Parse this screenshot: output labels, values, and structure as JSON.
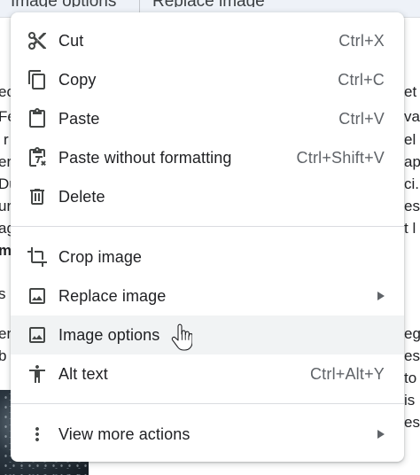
{
  "toolbar": {
    "buttons": [
      "Image options",
      "Replace image"
    ]
  },
  "document_fragments": {
    "left": [
      "ec",
      "Fe",
      "r",
      "er",
      "Du",
      "ur",
      "ag",
      "m",
      "s",
      "er",
      "b"
    ],
    "right": [
      "et",
      "va",
      "el",
      "ap",
      "ci.",
      "es",
      "t l",
      "eg",
      "es",
      "to",
      "is",
      "es"
    ]
  },
  "context_menu": {
    "items": [
      {
        "label": "Cut",
        "shortcut": "Ctrl+X",
        "icon": "scissors-icon"
      },
      {
        "label": "Copy",
        "shortcut": "Ctrl+C",
        "icon": "copy-icon"
      },
      {
        "label": "Paste",
        "shortcut": "Ctrl+V",
        "icon": "clipboard-icon"
      },
      {
        "label": "Paste without formatting",
        "shortcut": "Ctrl+Shift+V",
        "icon": "clipboard-clear-format-icon"
      },
      {
        "label": "Delete",
        "shortcut": "",
        "icon": "trash-icon"
      },
      {
        "label": "Crop image",
        "shortcut": "",
        "icon": "crop-icon"
      },
      {
        "label": "Replace image",
        "shortcut": "",
        "icon": "image-icon",
        "submenu": true
      },
      {
        "label": "Image options",
        "shortcut": "",
        "icon": "image-icon",
        "hovered": true
      },
      {
        "label": "Alt text",
        "shortcut": "Ctrl+Alt+Y",
        "icon": "accessibility-icon"
      },
      {
        "label": "View more actions",
        "shortcut": "",
        "icon": "more-vert-icon",
        "submenu": true
      }
    ]
  },
  "colors": {
    "menu_bg": "#ffffff",
    "hover_bg": "#f1f3f4",
    "text": "#202124",
    "shortcut_text": "#5f6368",
    "icon": "#444746",
    "divider": "#dadce0"
  }
}
